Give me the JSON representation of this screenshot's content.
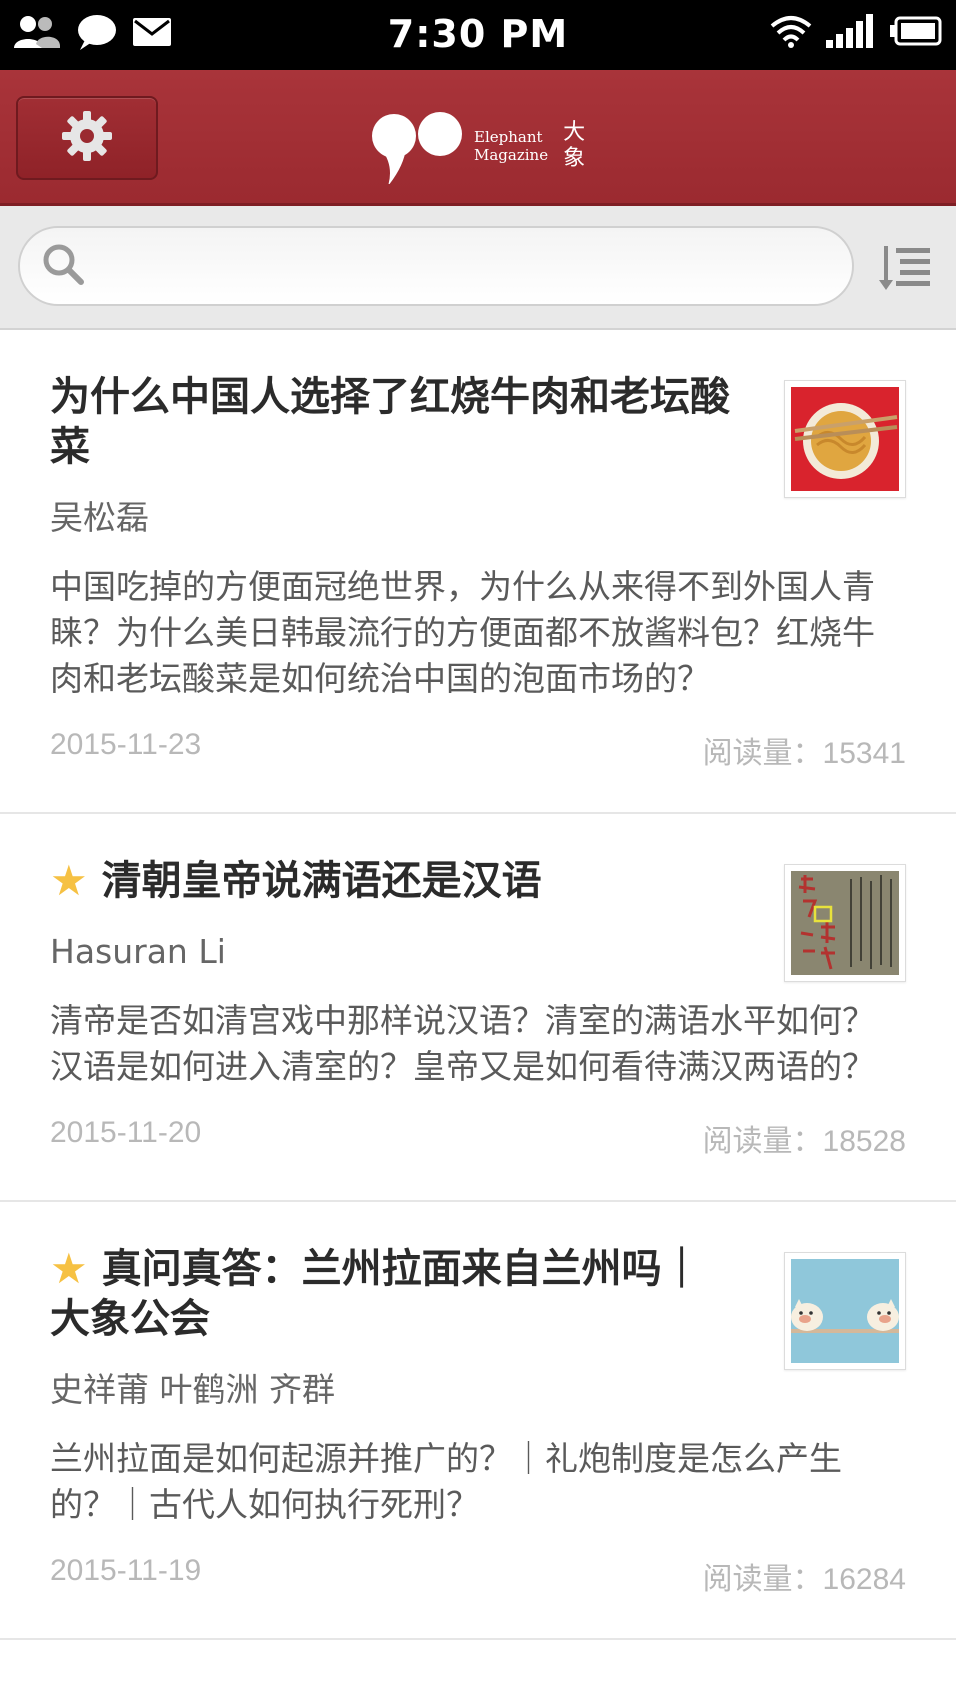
{
  "status_bar": {
    "time": "7:30 PM",
    "icons_left": [
      "contacts-icon",
      "chat-bubble-icon",
      "mail-icon"
    ],
    "icons_right": [
      "wifi-icon",
      "signal-icon",
      "battery-icon"
    ]
  },
  "header": {
    "settings_icon": "gear-icon",
    "logo_en_line1": "Elephant",
    "logo_en_line2": "Magazine",
    "logo_cn_line1": "大",
    "logo_cn_line2": "象",
    "brand_color": "#a3303a"
  },
  "search": {
    "placeholder": "",
    "value": "",
    "search_icon": "search-icon",
    "sort_icon": "sort-list-icon"
  },
  "articles": [
    {
      "starred": false,
      "title": "为什么中国人选择了红烧牛肉和老坛酸菜",
      "author": "吴松磊",
      "summary": "中国吃掉的方便面冠绝世界，为什么从来得不到外国人青睐？为什么美日韩最流行的方便面都不放酱料包？红烧牛肉和老坛酸菜是如何统治中国的泡面市场的？",
      "date": "2015-11-23",
      "views": "阅读量：15341",
      "thumb": "noodle-bowl-image"
    },
    {
      "starred": true,
      "title": "清朝皇帝说满语还是汉语",
      "author": "Hasuran Li",
      "summary": "清帝是否如清宫戏中那样说汉语？清室的满语水平如何？汉语是如何进入清室的？皇帝又是如何看待满汉两语的？",
      "date": "2015-11-20",
      "views": "阅读量：18528",
      "thumb": "manuscript-image"
    },
    {
      "starred": true,
      "title": "真问真答：兰州拉面来自兰州吗｜大象公会",
      "author": "史祥莆 叶鹤洲 齐群",
      "summary": "兰州拉面是如何起源并推广的？｜礼炮制度是怎么产生的？｜古代人如何执行死刑？",
      "date": "2015-11-19",
      "views": "阅读量：16284",
      "thumb": "cartoon-cats-image"
    }
  ]
}
